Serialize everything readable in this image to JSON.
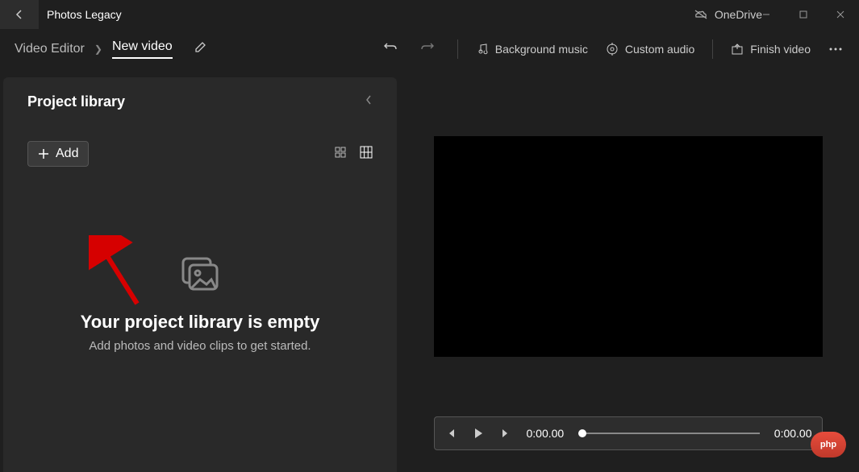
{
  "app": {
    "title": "Photos Legacy"
  },
  "cloud": {
    "label": "OneDrive"
  },
  "breadcrumb": {
    "root": "Video Editor",
    "current": "New video"
  },
  "toolbar": {
    "background_music": "Background music",
    "custom_audio": "Custom audio",
    "finish_video": "Finish video"
  },
  "library": {
    "title": "Project library",
    "add_label": "Add",
    "empty_title": "Your project library is empty",
    "empty_subtitle": "Add photos and video clips to get started."
  },
  "playback": {
    "current_time": "0:00.00",
    "total_time": "0:00.00"
  },
  "watermark": {
    "text": "php"
  }
}
